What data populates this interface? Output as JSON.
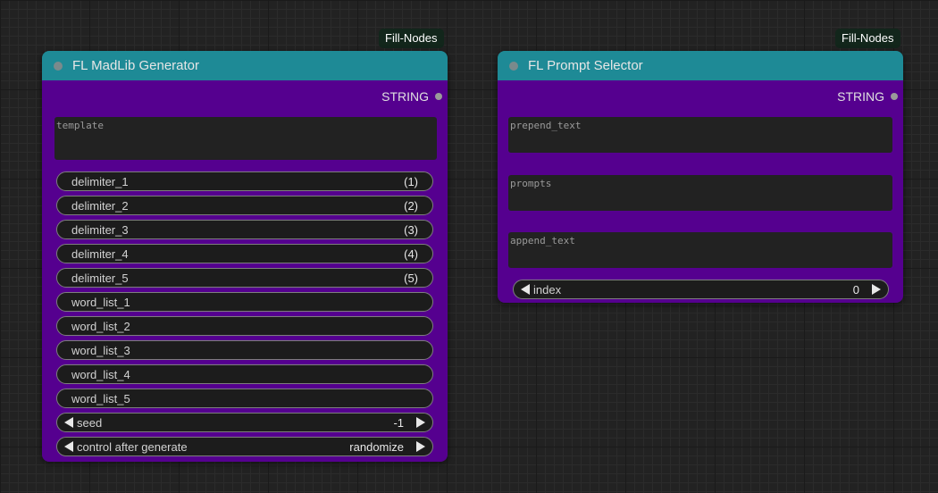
{
  "colors": {
    "canvas": "#222222",
    "node_header": "#1e8a96",
    "node_body": "#55008f",
    "badge_bg": "#12261b"
  },
  "nodes": [
    {
      "badge": "Fill-Nodes",
      "title": "FL MadLib Generator",
      "output": "STRING",
      "textareas": [
        {
          "placeholder": "template"
        }
      ],
      "fields": [
        {
          "label": "delimiter_1",
          "value": "(1)"
        },
        {
          "label": "delimiter_2",
          "value": "(2)"
        },
        {
          "label": "delimiter_3",
          "value": "(3)"
        },
        {
          "label": "delimiter_4",
          "value": "(4)"
        },
        {
          "label": "delimiter_5",
          "value": "(5)"
        },
        {
          "label": "word_list_1",
          "value": ""
        },
        {
          "label": "word_list_2",
          "value": ""
        },
        {
          "label": "word_list_3",
          "value": ""
        },
        {
          "label": "word_list_4",
          "value": ""
        },
        {
          "label": "word_list_5",
          "value": ""
        }
      ],
      "combos": [
        {
          "label": "seed",
          "value": "-1"
        },
        {
          "label": "control after generate",
          "value": "randomize"
        }
      ]
    },
    {
      "badge": "Fill-Nodes",
      "title": "FL Prompt Selector",
      "output": "STRING",
      "textareas": [
        {
          "placeholder": "prepend_text"
        },
        {
          "placeholder": "prompts"
        },
        {
          "placeholder": "append_text"
        }
      ],
      "fields": [],
      "combos": [
        {
          "label": "index",
          "value": "0"
        }
      ]
    }
  ]
}
